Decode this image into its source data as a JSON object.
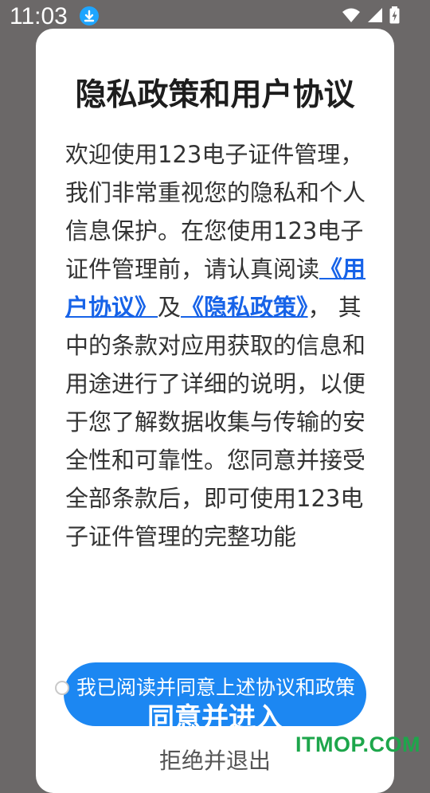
{
  "status_bar": {
    "time": "11:03",
    "icons": [
      "download-icon",
      "wifi-icon",
      "signal-icon",
      "battery-charging-icon"
    ]
  },
  "dialog": {
    "title": "隐私政策和用户协议",
    "body": {
      "intro": "欢迎使用123电子证件管理，我们非常重视您的隐私和个人信息保护。在您使用123电子证件管理前，请认真阅读",
      "user_agreement_link": "《用户协议》",
      "conjunction": "及",
      "privacy_policy_link": "《隐私政策》",
      "rest": "， 其中的条款对应用获取的信息和用途进行了详细的说明，以便于您了解数据收集与传输的安全性和可靠性。您同意并接受全部条款后，即可使用123电子证件管理的完整功能"
    },
    "consent_checkbox_label": "我已阅读并同意上述协议和政策",
    "agree_button": "同意并进入",
    "reject_button": "拒绝并退出"
  },
  "watermark": "ITMOP.COM",
  "colors": {
    "link": "#1763e8",
    "primary_button": "#1c87f2",
    "watermark": "#1da64b"
  }
}
